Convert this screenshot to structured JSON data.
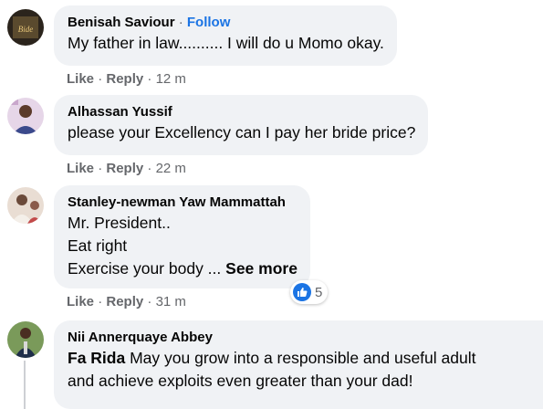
{
  "comments": [
    {
      "author": "Benisah Saviour",
      "separator": "·",
      "follow_label": "Follow",
      "lines": [
        "My father in law.......... I will do u Momo okay."
      ],
      "like_label": "Like",
      "reply_label": "Reply",
      "time": "12 m",
      "avatar_icon": "profile-photo"
    },
    {
      "author": "Alhassan Yussif",
      "lines": [
        "please your Excellency can I pay her bride price?"
      ],
      "like_label": "Like",
      "reply_label": "Reply",
      "time": "22 m",
      "avatar_icon": "profile-photo"
    },
    {
      "author": "Stanley-newman Yaw Mammattah",
      "lines": [
        "Mr. President..",
        "Eat right",
        "Exercise your body ..."
      ],
      "see_more": "See more",
      "like_label": "Like",
      "reply_label": "Reply",
      "time": "31 m",
      "reaction_count": "5",
      "reaction_icon": "like-icon",
      "avatar_icon": "profile-photo"
    },
    {
      "author": "Nii Annerquaye Abbey",
      "mention": "Fa Rida",
      "lines": [
        " May you grow into a responsible and useful adult",
        "and achieve exploits even greater than your dad!"
      ],
      "avatar_icon": "profile-photo"
    }
  ],
  "separator": "·",
  "colors": {
    "bubble": "#f0f2f5",
    "meta": "#65676b",
    "accent": "#1b74e4"
  }
}
